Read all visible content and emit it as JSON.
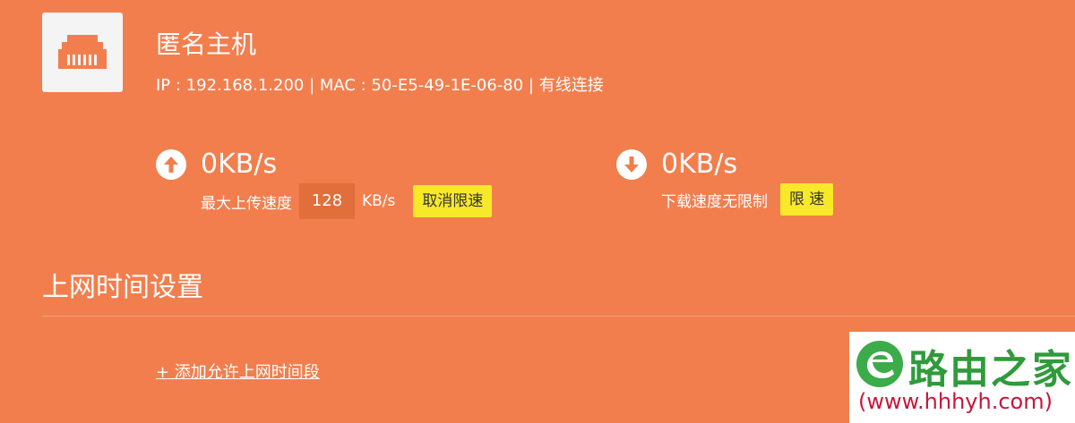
{
  "device": {
    "name": "匿名主机",
    "info": "IP : 192.168.1.200 | MAC : 50-E5-49-1E-06-80 | 有线连接",
    "icon": "ethernet-port-icon"
  },
  "upload": {
    "icon": "arrow-up-circle-icon",
    "value": "0KB/s",
    "label": "最大上传速度",
    "limit_value": "128",
    "unit": "KB/s",
    "button_label": "取消限速"
  },
  "download": {
    "icon": "arrow-down-circle-icon",
    "value": "0KB/s",
    "label": "下载速度无限制",
    "button_label": "限 速"
  },
  "schedule": {
    "title": "上网时间设置",
    "add_link": "+ 添加允许上网时间段"
  },
  "watermark": {
    "title": "路由之家",
    "url": "(www.hhhyh.com)",
    "logo": "e-logo-icon"
  },
  "colors": {
    "background": "#f27e4e",
    "button_yellow": "#f7e82a",
    "input_bg": "#e06f3c",
    "watermark_green": "#2f9b3b",
    "watermark_red": "#c8163a"
  }
}
